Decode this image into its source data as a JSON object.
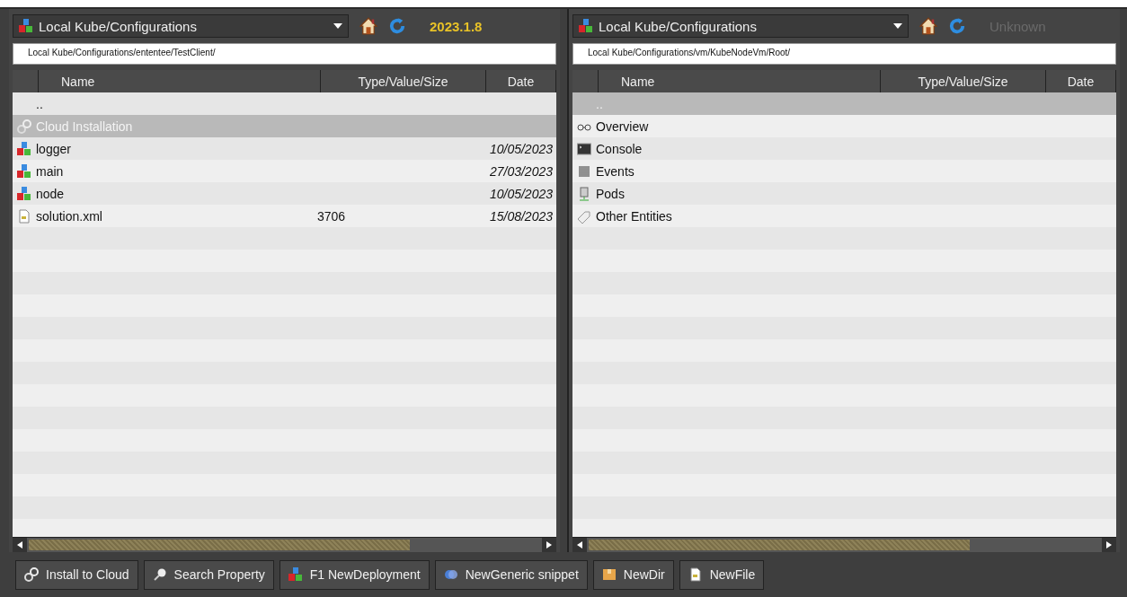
{
  "panels": [
    {
      "location": "Local Kube/Configurations",
      "version": {
        "text": "2023.1.8",
        "known": true
      },
      "path": "Local Kube/Configurations/ententee/TestClient/",
      "columns": [
        "Name",
        "Type/Value/Size",
        "Date"
      ],
      "rows": [
        {
          "kind": "parent",
          "name": "..",
          "selected": false
        },
        {
          "kind": "cloud",
          "name": "Cloud Installation",
          "selected": true
        },
        {
          "kind": "deployment",
          "name": "logger",
          "date": "10/05/2023",
          "selected": false
        },
        {
          "kind": "deployment",
          "name": "main",
          "date": "27/03/2023",
          "selected": false
        },
        {
          "kind": "deployment",
          "name": "node",
          "date": "10/05/2023",
          "selected": false
        },
        {
          "kind": "file",
          "name": "solution.xml",
          "size": "3706",
          "date": "15/08/2023",
          "selected": false
        }
      ]
    },
    {
      "location": "Local Kube/Configurations",
      "version": {
        "text": "Unknown",
        "known": false
      },
      "path": "Local Kube/Configurations/vm/KubeNodeVm/Root/",
      "columns": [
        "Name",
        "Type/Value/Size",
        "Date"
      ],
      "rows": [
        {
          "kind": "parent",
          "name": "..",
          "selected": true
        },
        {
          "kind": "overview",
          "name": "Overview",
          "selected": false
        },
        {
          "kind": "console",
          "name": "Console",
          "selected": false
        },
        {
          "kind": "events",
          "name": "Events",
          "selected": false
        },
        {
          "kind": "pods",
          "name": "Pods",
          "selected": false
        },
        {
          "kind": "entities",
          "name": "Other Entities",
          "selected": false
        }
      ]
    }
  ],
  "buttons": [
    {
      "kind": "cloud",
      "label": "Install to Cloud"
    },
    {
      "kind": "search",
      "label": "Search Property"
    },
    {
      "kind": "deployment",
      "label": "F1 NewDeployment"
    },
    {
      "kind": "snippet",
      "label": "NewGeneric snippet"
    },
    {
      "kind": "dir",
      "label": "NewDir"
    },
    {
      "kind": "file",
      "label": "NewFile"
    }
  ]
}
